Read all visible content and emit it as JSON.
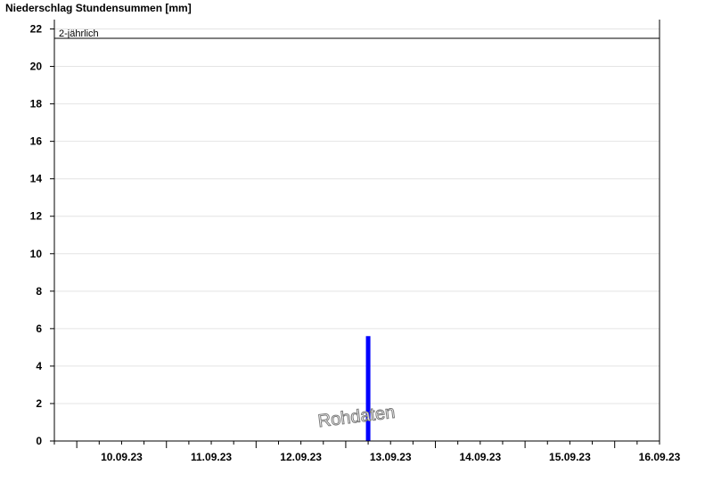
{
  "chart_data": {
    "type": "bar",
    "title": "Niederschlag Stundensummen [mm]",
    "xlabel": "",
    "ylabel": "",
    "ylim": [
      0,
      22.5
    ],
    "y_ticks": [
      0,
      2,
      4,
      6,
      8,
      10,
      12,
      14,
      16,
      18,
      20,
      22
    ],
    "x_range_days": [
      "09.09.23 18:00",
      "16.09.23 12:00"
    ],
    "x_tick_labels": [
      "10.09.23",
      "11.09.23",
      "12.09.23",
      "13.09.23",
      "14.09.23",
      "15.09.23",
      "16.09.23"
    ],
    "grid": "horizontal",
    "series": [
      {
        "color": "#0000ff",
        "points": [
          {
            "time": "13.09.23 06:00",
            "value": 5.6
          }
        ]
      }
    ],
    "reference_lines": [
      {
        "label": "2-jährlich",
        "value": 21.5,
        "color": "#000000"
      }
    ],
    "watermark": "Rohdaten"
  }
}
